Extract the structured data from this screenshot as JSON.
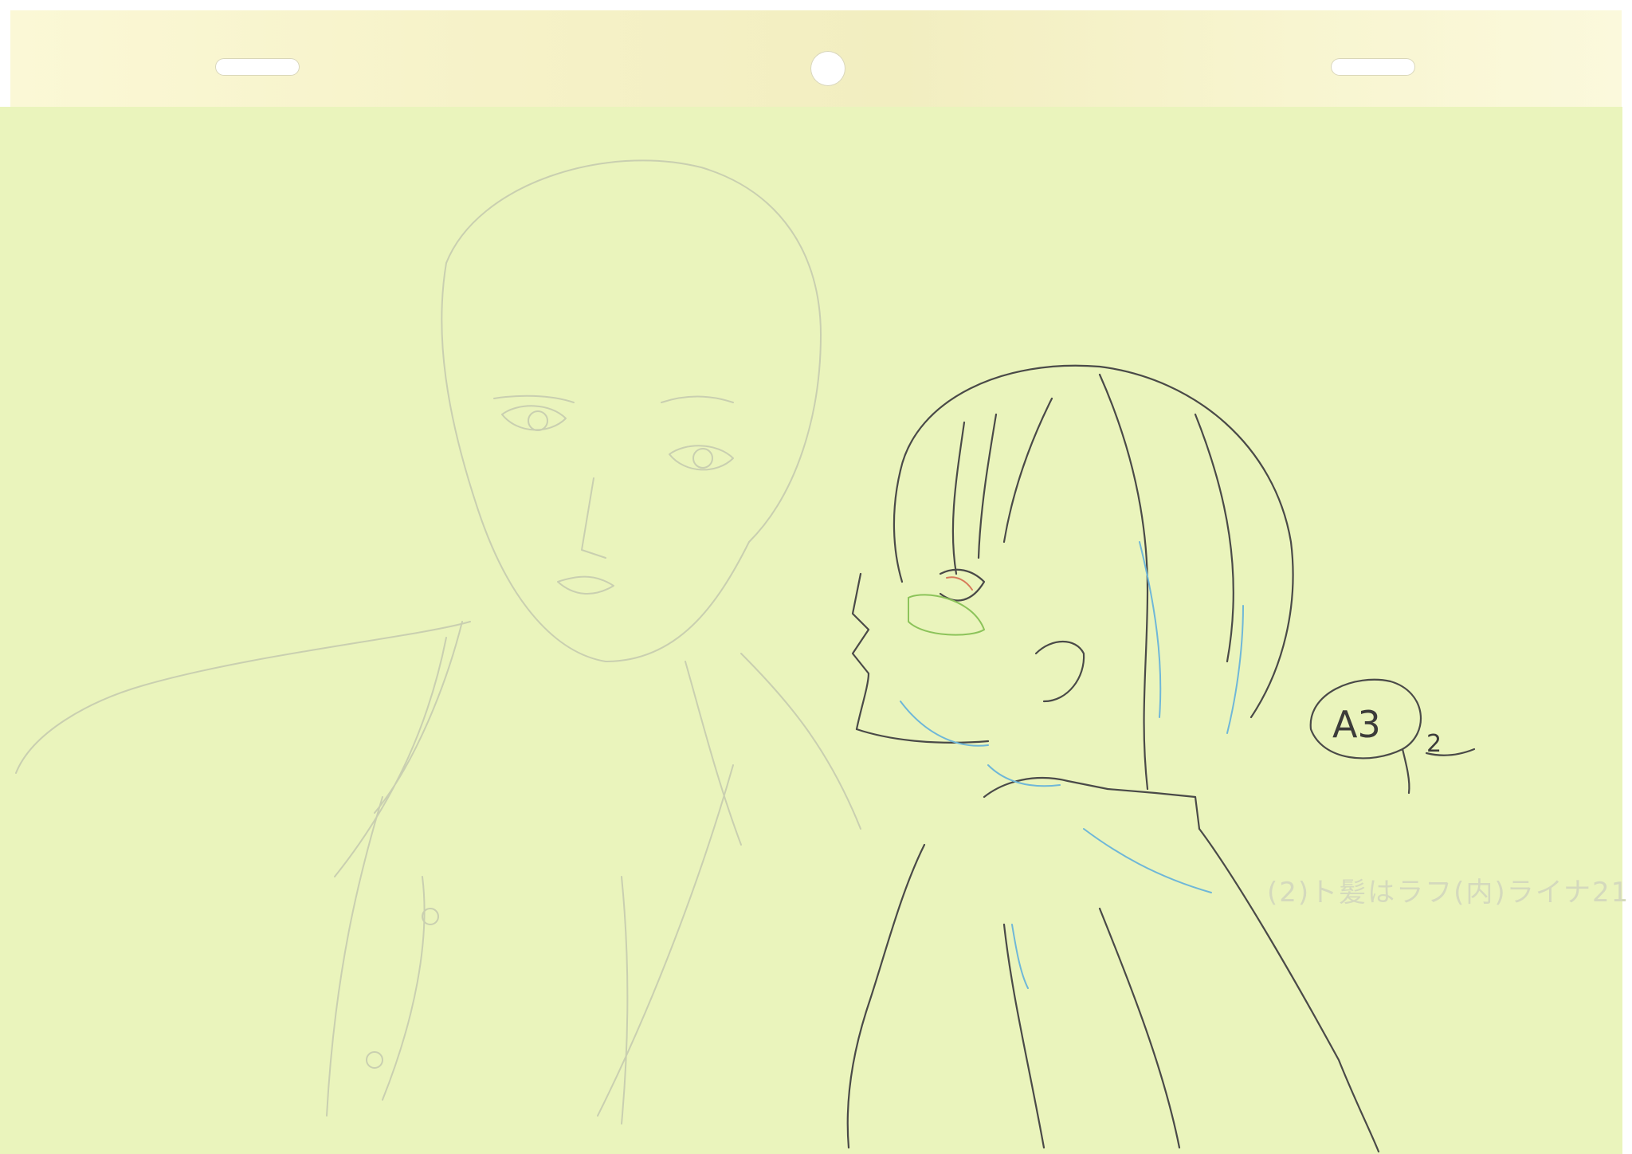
{
  "sheet": {
    "paper_color": "#eaf4bc",
    "header_color": "#f7f4cc",
    "line_color": "#4a4a48",
    "accent_colors": [
      "#6fb7d8",
      "#8cc35a",
      "#d77a5a"
    ]
  },
  "annotations": {
    "cut_mark": "A3",
    "cut_suffix": "2",
    "pencil_note": "(2)ト髪はラフ(内)ライナ21"
  }
}
